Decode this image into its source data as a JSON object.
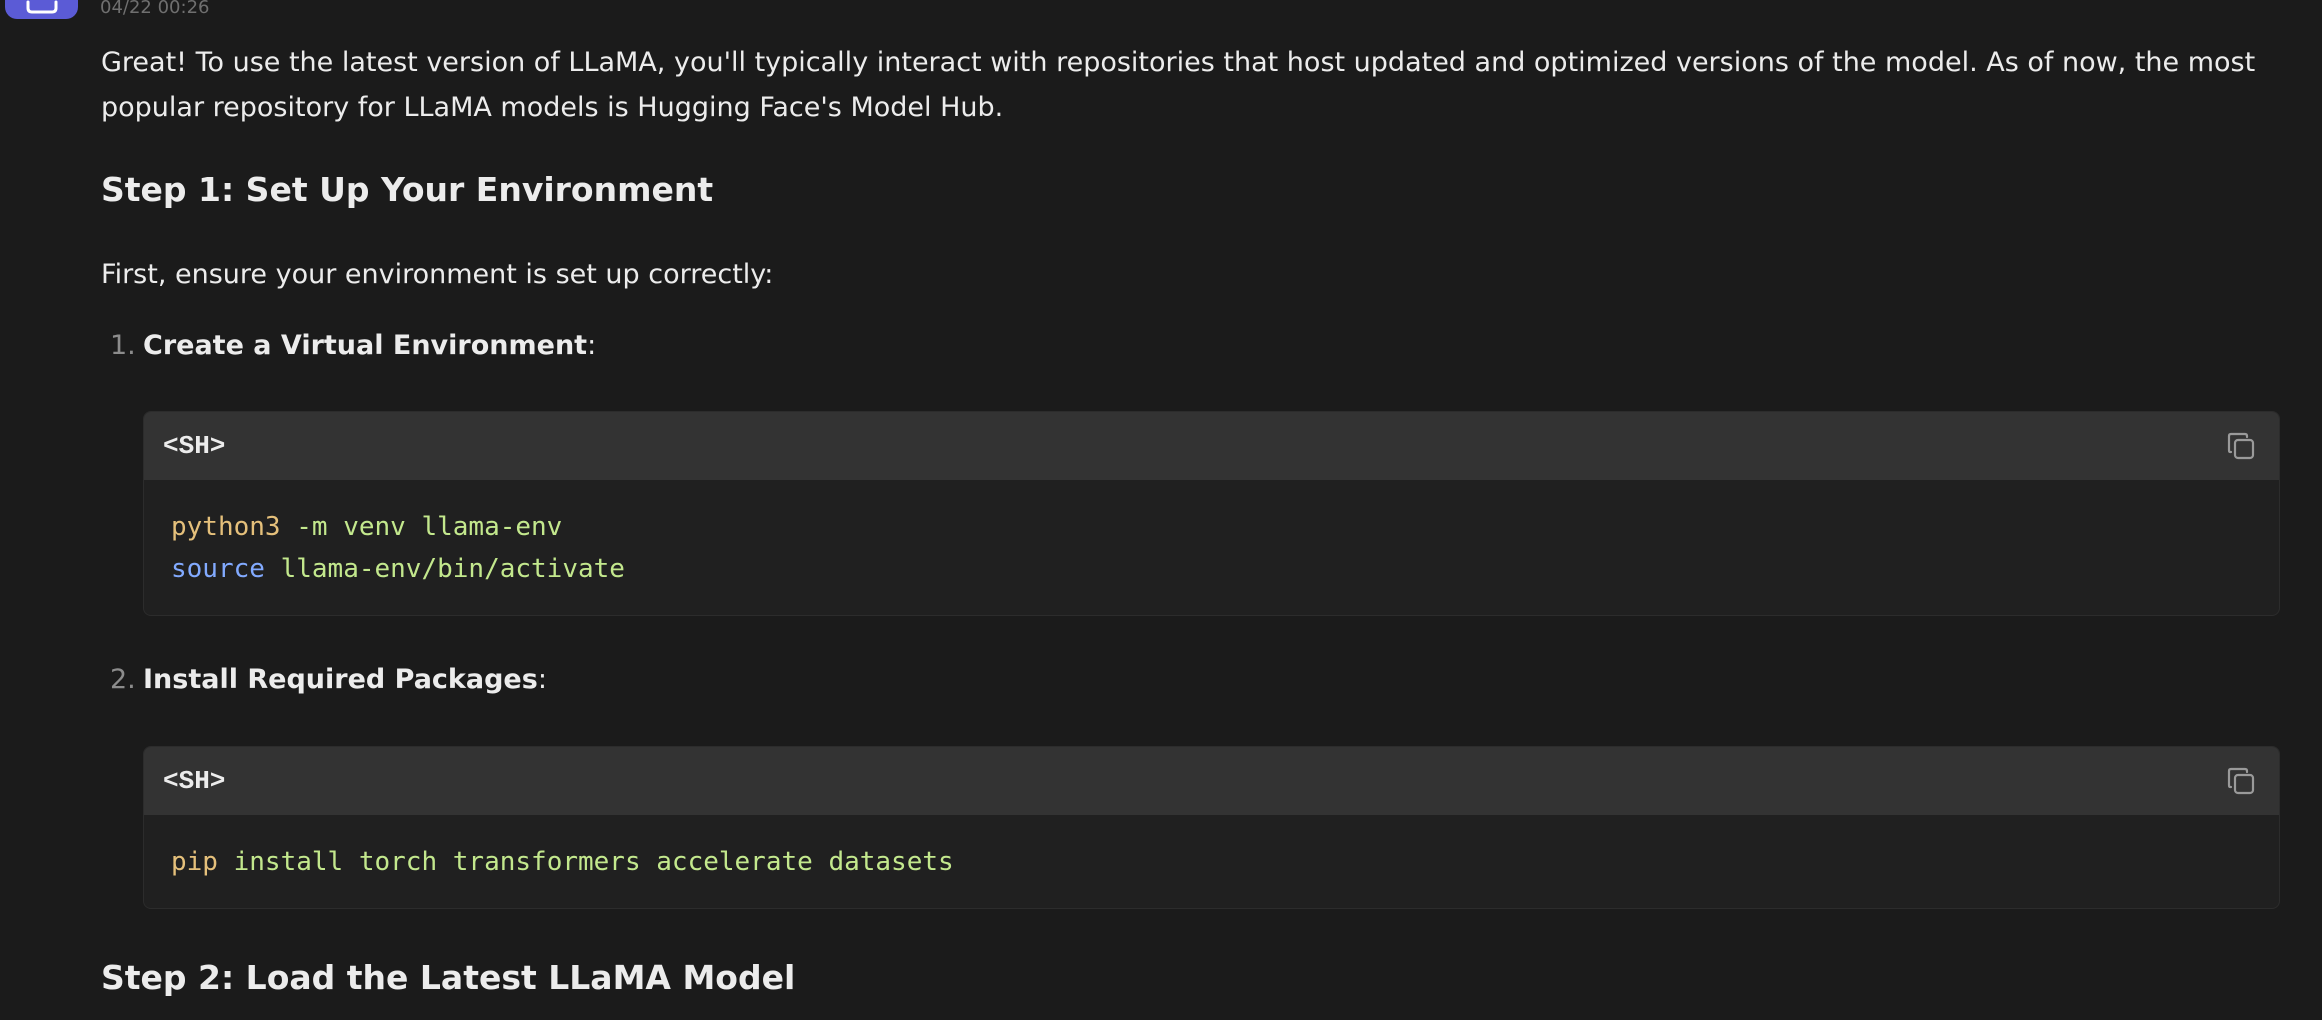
{
  "message": {
    "timestamp": "04/22 00:26",
    "intro": "Great! To use the latest version of LLaMA, you'll typically interact with repositories that host updated and optimized versions of the model. As of now, the most popular repository for LLaMA models is Hugging Face's Model Hub.",
    "step1": {
      "heading": "Step 1: Set Up Your Environment",
      "lead": "First, ensure your environment is set up correctly:",
      "items": [
        {
          "number": "1.",
          "title": "Create a Virtual Environment",
          "suffix": ":",
          "code": {
            "language": "<SH>",
            "lines": [
              {
                "cmd": "python3",
                "rest": " -m venv llama-env"
              },
              {
                "cmd": "source",
                "rest": " llama-env/bin/activate"
              }
            ]
          }
        },
        {
          "number": "2.",
          "title": "Install Required Packages",
          "suffix": ":",
          "code": {
            "language": "<SH>",
            "lines": [
              {
                "cmd": "pip",
                "rest": " install torch transformers accelerate datasets"
              }
            ]
          }
        }
      ]
    },
    "step2": {
      "heading": "Step 2: Load the Latest LLaMA Model"
    }
  },
  "colors": {
    "background": "#1b1b1b",
    "avatar": "#5b5bd6",
    "code_header": "#333333",
    "code_body": "#202020"
  },
  "icons": {
    "avatar": "bot-avatar-icon",
    "copy": "copy-icon"
  }
}
